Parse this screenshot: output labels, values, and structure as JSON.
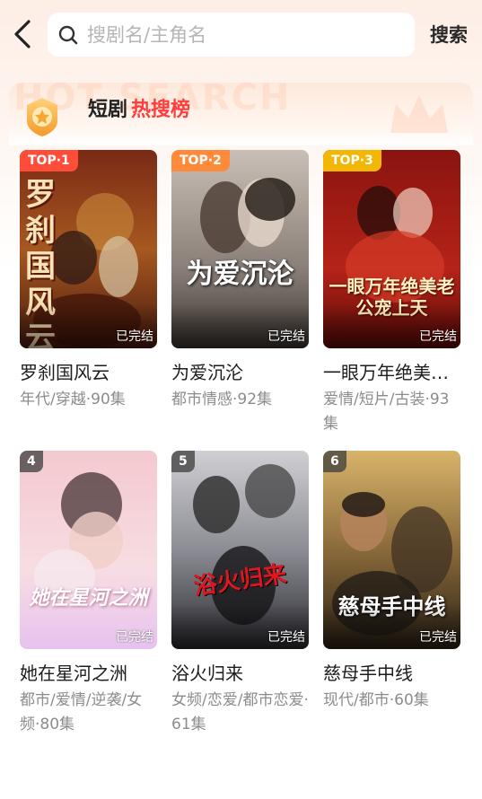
{
  "header": {
    "search_placeholder": "搜剧名/主角名",
    "search_button": "搜索"
  },
  "rank": {
    "title_prefix": "短剧",
    "title_highlight": "热搜榜"
  },
  "colors": {
    "accent_red": "#ff3d3d",
    "top1": "#ff4d3a",
    "top2": "#ff8a3a",
    "top3": "#f2b705"
  },
  "dramas": [
    {
      "rank_label": "TOP·1",
      "poster_text": "罗刹国风云",
      "status": "已完结",
      "title": "罗刹国风云",
      "tags": "年代/穿越·90集"
    },
    {
      "rank_label": "TOP·2",
      "poster_text": "为爱沉沦",
      "status": "已完结",
      "title": "为爱沉沦",
      "tags": "都市情感·92集"
    },
    {
      "rank_label": "TOP·3",
      "poster_text": "一眼万年绝美老公宠上天",
      "status": "已完结",
      "title": "一眼万年绝美老公宠上天",
      "tags": "爱情/短片/古装·93集"
    },
    {
      "rank_label": "4",
      "poster_text": "她在星河之洲",
      "status": "已完结",
      "title": "她在星河之洲",
      "tags": "都市/爱情/逆袭/女频·80集"
    },
    {
      "rank_label": "5",
      "poster_text": "浴火归来",
      "status": "已完结",
      "title": "浴火归来",
      "tags": "女频/恋爱/都市恋爱·61集"
    },
    {
      "rank_label": "6",
      "poster_text": "慈母手中线",
      "status": "已完结",
      "title": "慈母手中线",
      "tags": "现代/都市·60集"
    }
  ]
}
